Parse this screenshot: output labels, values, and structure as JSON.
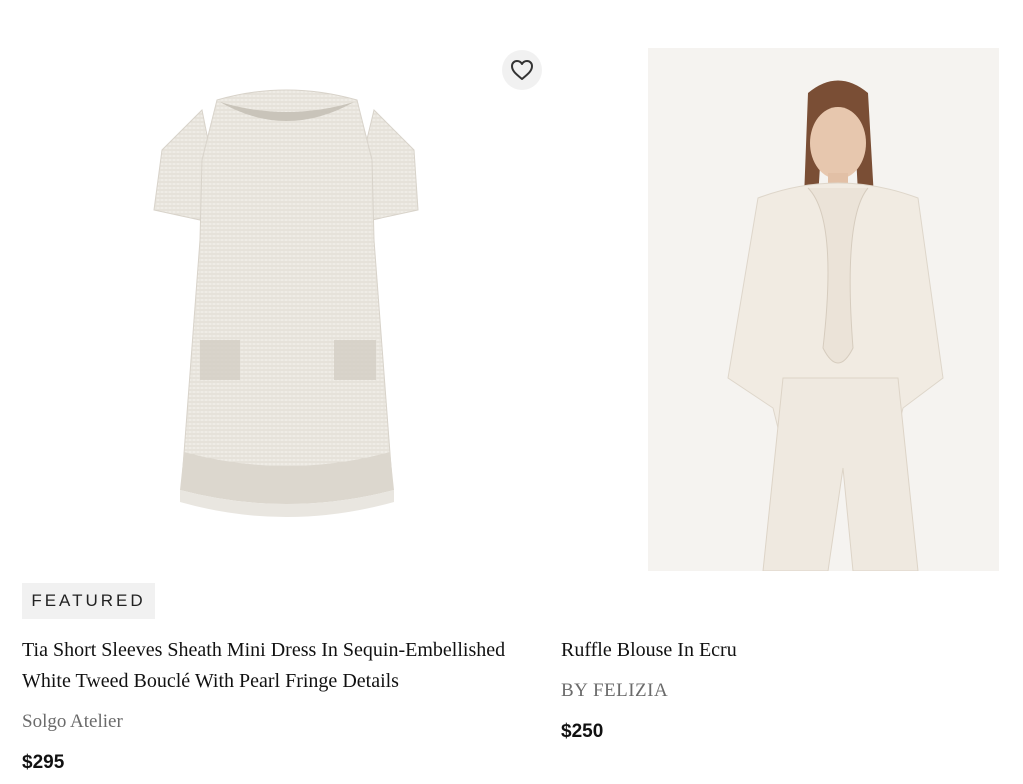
{
  "products": [
    {
      "image_alt": "",
      "badge": "FEATURED",
      "title": "Tia Short Sleeves Sheath Mini Dress In Sequin-Embellished White Tweed Bouclé With Pearl Fringe Details",
      "brand": "Solgo Atelier",
      "price": "$295",
      "wishlist_icon": "heart-outline-icon"
    },
    {
      "title": "Ruffle Blouse In Ecru",
      "brand": "BY FELIZIA",
      "price": "$250"
    }
  ],
  "colors": {
    "text": "#111111",
    "muted": "#6b6b6b",
    "badge_bg": "#f1f1f1"
  }
}
